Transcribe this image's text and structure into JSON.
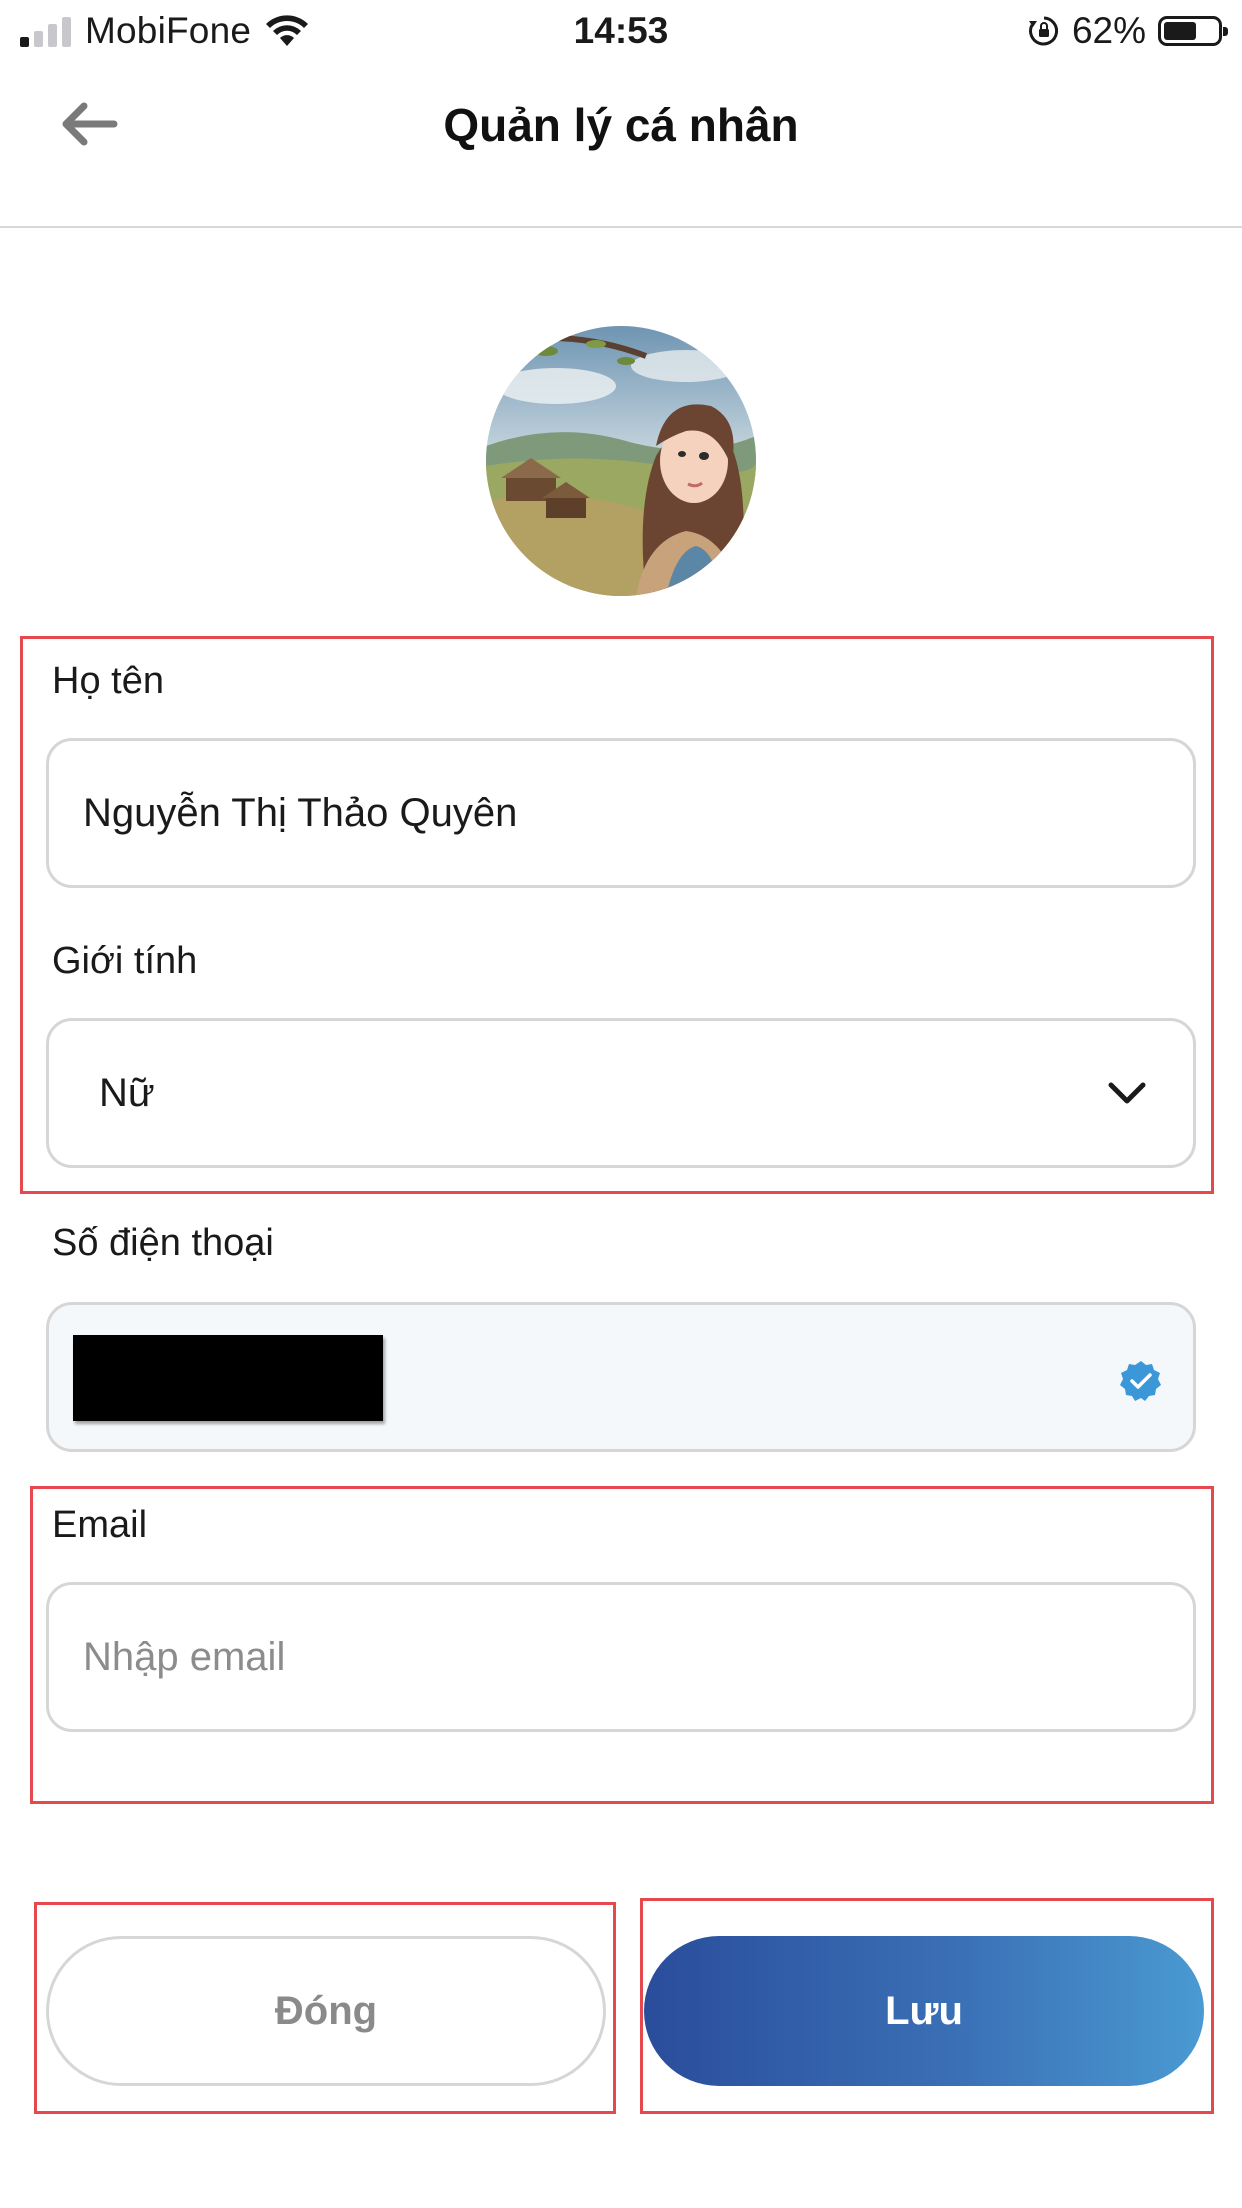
{
  "status_bar": {
    "carrier": "MobiFone",
    "time": "14:53",
    "battery_percent": "62%",
    "battery_level": 0.62,
    "signal_bars_active": 1,
    "icons": [
      "signal-icon",
      "wifi-icon",
      "rotation-lock-icon",
      "battery-icon"
    ]
  },
  "header": {
    "title": "Quản lý cá nhân",
    "back_icon": "arrow-left-icon"
  },
  "profile": {
    "avatar": "illustrated portrait avatar"
  },
  "form": {
    "name": {
      "label": "Họ tên",
      "value": "Nguyễn Thị Thảo Quyên"
    },
    "gender": {
      "label": "Giới tính",
      "selected": "Nữ",
      "icon": "chevron-down-icon"
    },
    "phone": {
      "label": "Số điện thoại",
      "value_redacted": true,
      "verified_icon": "verified-badge-icon"
    },
    "email": {
      "label": "Email",
      "placeholder": "Nhập email",
      "value": ""
    }
  },
  "actions": {
    "close_label": "Đóng",
    "save_label": "Lưu"
  },
  "colors": {
    "highlight_border": "#e5484d",
    "save_gradient_start": "#2a4d9b",
    "save_gradient_end": "#4a9ad2",
    "verified_badge": "#3b97d8"
  }
}
